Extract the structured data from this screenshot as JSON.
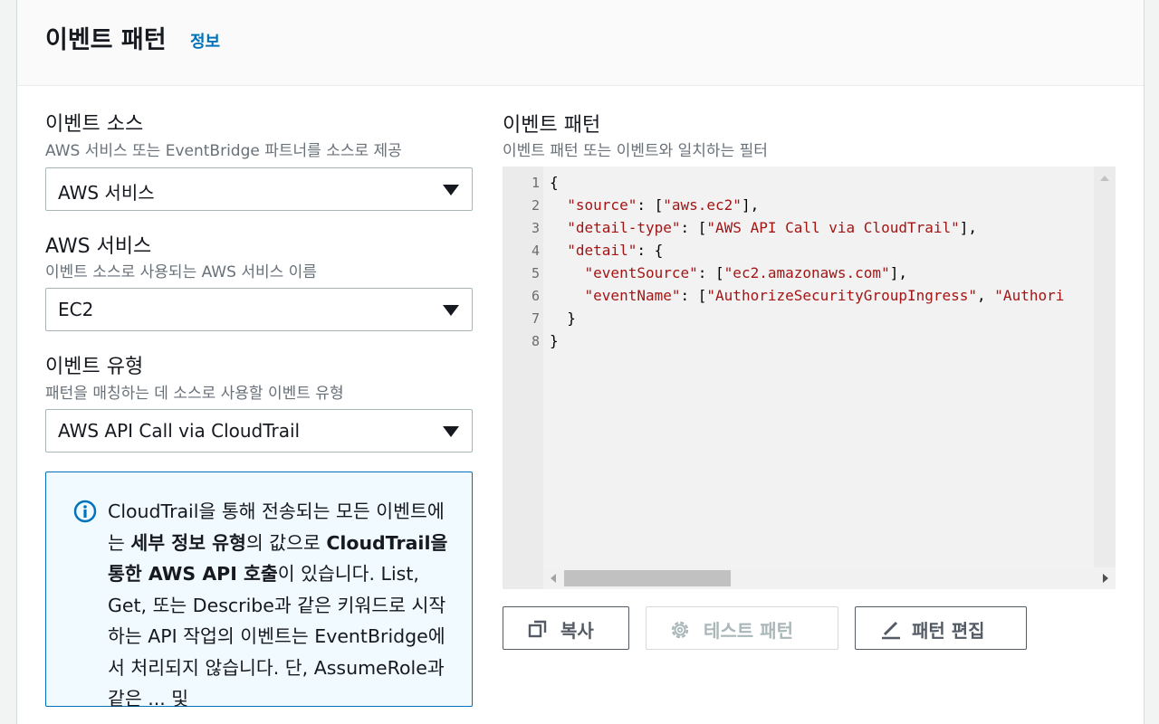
{
  "header": {
    "title": "이벤트 패턴",
    "info_link": "정보"
  },
  "source_field": {
    "label": "이벤트 소스",
    "description": "AWS 서비스 또는 EventBridge 파트너를 소스로 제공",
    "value": "AWS 서비스"
  },
  "service_field": {
    "label": "AWS 서비스",
    "description": "이벤트 소스로 사용되는 AWS 서비스 이름",
    "value": "EC2"
  },
  "event_type_field": {
    "label": "이벤트 유형",
    "description": "패턴을 매칭하는 데 소스로 사용할 이벤트 유형",
    "value": "AWS API Call via CloudTrail"
  },
  "alert": {
    "icon": "info-icon",
    "text_part1": "CloudTrail을 통해 전송되는 모든 이벤트에는 ",
    "text_bold1": "세부 정보 유형",
    "text_part2": "의 값으로 ",
    "text_bold2": "CloudTrail을 통한 AWS API 호출",
    "text_part3": "이 있습니다. List, Get, 또는 Describe과 같은 키워드로 시작하는 API 작업의 이벤트는 EventBridge에서 처리되지 않습니다. 단, AssumeRole과 같은 ... 및"
  },
  "pattern": {
    "label": "이벤트 패턴",
    "description": "이벤트 패턴 또는 이벤트와 일치하는 필터",
    "line_numbers": [
      "1",
      "2",
      "3",
      "4",
      "5",
      "6",
      "7",
      "8"
    ],
    "lines": [
      "{",
      "  \"source\": [\"aws.ec2\"],",
      "  \"detail-type\": [\"AWS API Call via CloudTrail\"],",
      "  \"detail\": {",
      "    \"eventSource\": [\"ec2.amazonaws.com\"],",
      "    \"eventName\": [\"AuthorizeSecurityGroupIngress\", \"Authori",
      "  }",
      "}"
    ]
  },
  "buttons": {
    "copy": "복사",
    "test": "테스트 패턴",
    "edit": "패턴 편집"
  },
  "colors": {
    "link": "#0073bb",
    "alert_border": "#0073bb",
    "alert_bg": "#f1faff",
    "code_string": "#a31515"
  }
}
